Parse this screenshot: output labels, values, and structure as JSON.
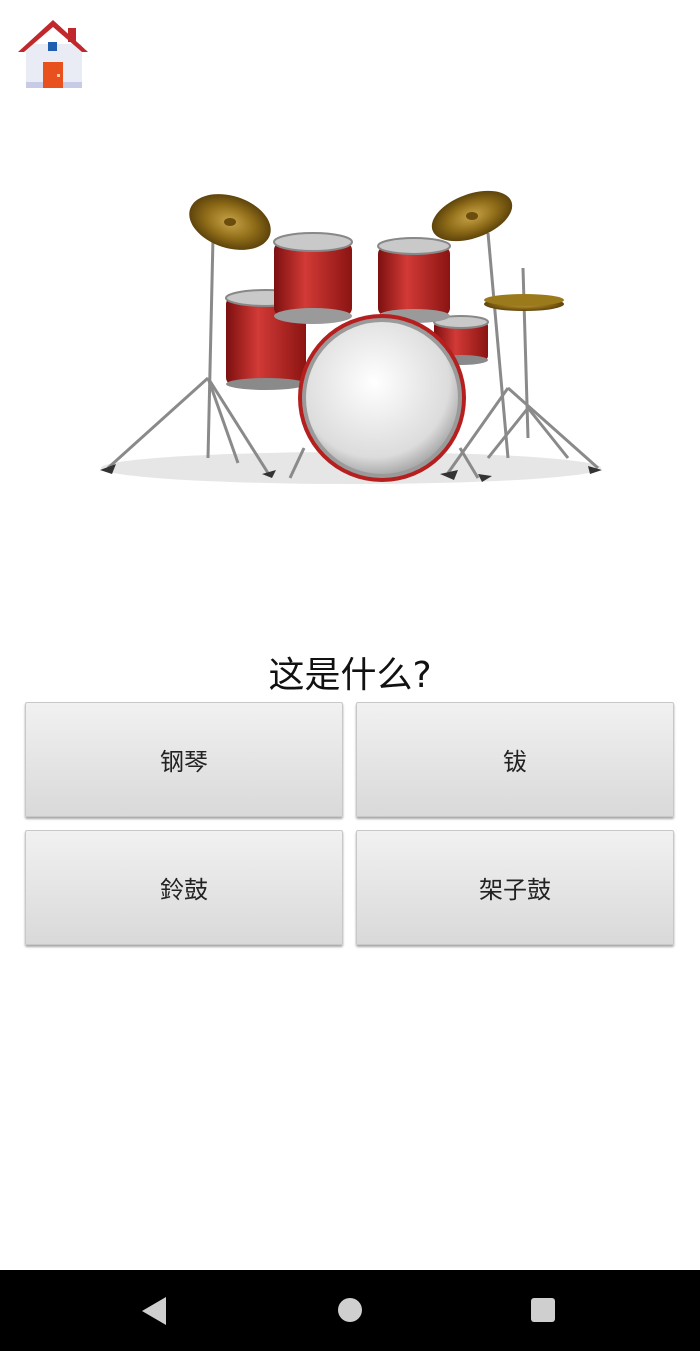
{
  "header": {
    "home_icon": "house-icon"
  },
  "illustration": {
    "subject": "drum-kit-image"
  },
  "question": {
    "text": "这是什么?"
  },
  "answers": [
    {
      "label": "钢琴"
    },
    {
      "label": "钹"
    },
    {
      "label": "鈴鼓"
    },
    {
      "label": "架子鼓"
    }
  ],
  "navigation": {
    "back_icon": "back-triangle-icon",
    "home_icon": "home-circle-icon",
    "recents_icon": "recents-square-icon"
  },
  "colors": {
    "answer_button_top": "#f1f1f1",
    "answer_button_bottom": "#d9d9d9",
    "nav_bar": "#000000",
    "drum_shell": "#b5201f",
    "cymbal": "#9b7a1c",
    "house_roof": "#c0282b",
    "house_door": "#e8501d"
  }
}
